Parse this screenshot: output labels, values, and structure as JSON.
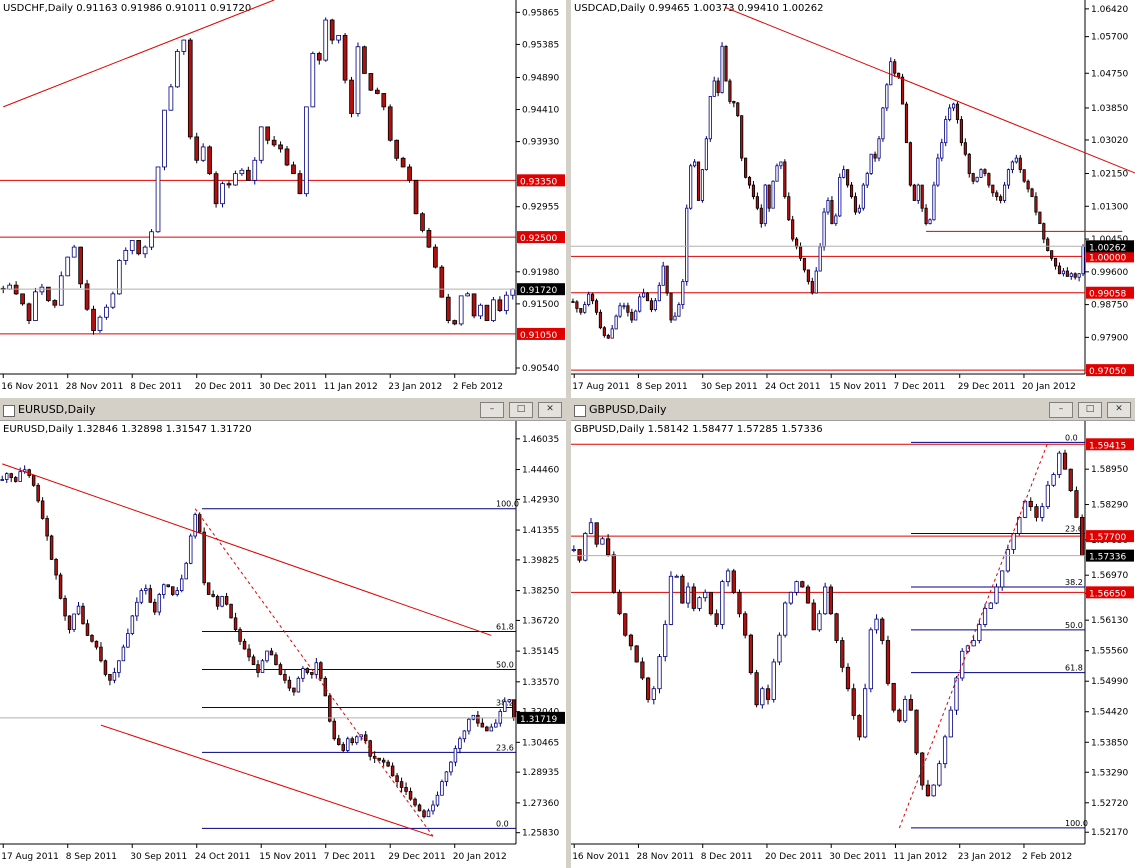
{
  "colors": {
    "bull": "#ffffff",
    "bull_outline": "#000080",
    "bear": "#b01010",
    "bear_outline": "#000000",
    "level_line": "#e00000",
    "fib_line": "#000080",
    "axis_text": "#000000",
    "price_box_black": "#000000",
    "price_box_red": "#e00000"
  },
  "window_buttons": {
    "minimize": "–",
    "maximize": "□",
    "close": "✕"
  },
  "chart_data": [
    {
      "type": "candlestick",
      "symbol": "USDCHF",
      "title": "USDCHF,Daily",
      "ohlc_label": "0.91163 0.91986 0.91011 0.91720",
      "ylim": [
        0.9045,
        0.9605
      ],
      "yticks": [
        0.95865,
        0.95385,
        0.9489,
        0.9441,
        0.9393,
        0.92955,
        0.9198,
        0.915,
        0.9054
      ],
      "xticks": [
        "16 Nov 2011",
        "28 Nov 2011",
        "8 Dec 2011",
        "20 Dec 2011",
        "30 Dec 2011",
        "11 Jan 2012",
        "23 Jan 2012",
        "2 Feb 2012"
      ],
      "levels": [
        {
          "price": 0.9335,
          "label": "0.93350"
        },
        {
          "price": 0.925,
          "label": "0.92500"
        },
        {
          "price": 0.9105,
          "label": "0.91050"
        }
      ],
      "current_price": {
        "price": 0.9172,
        "label": "0.91720"
      },
      "trendlines": [
        {
          "from": [
            0,
            0.9445
          ],
          "to": [
            42,
            0.9605
          ]
        }
      ],
      "points": [
        0.9172,
        0.9178,
        0.9165,
        0.915,
        0.9125,
        0.9168,
        0.9175,
        0.9155,
        0.9148,
        0.9192,
        0.922,
        0.9235,
        0.918,
        0.9142,
        0.911,
        0.913,
        0.9145,
        0.9165,
        0.9215,
        0.923,
        0.9245,
        0.9225,
        0.9235,
        0.9258,
        0.9355,
        0.944,
        0.9475,
        0.9528,
        0.9545,
        0.94,
        0.9365,
        0.9385,
        0.9345,
        0.93,
        0.933,
        0.9328,
        0.9345,
        0.935,
        0.9335,
        0.9365,
        0.9415,
        0.9395,
        0.9388,
        0.9382,
        0.9358,
        0.9345,
        0.9315,
        0.9445,
        0.9525,
        0.9515,
        0.9575,
        0.9545,
        0.9552,
        0.9485,
        0.9435,
        0.9535,
        0.9495,
        0.947,
        0.9465,
        0.9445,
        0.9395,
        0.9368,
        0.9355,
        0.9335,
        0.9285,
        0.926,
        0.9235,
        0.9205,
        0.916,
        0.9125,
        0.912,
        0.9162,
        0.9165,
        0.9132,
        0.9148,
        0.9125,
        0.9156,
        0.914,
        0.9163,
        0.9172
      ]
    },
    {
      "type": "candlestick",
      "symbol": "USDCAD",
      "title": "USDCAD,Daily",
      "ohlc_label": "0.99465 1.00373 0.99410 1.00262",
      "ylim": [
        0.9695,
        1.0665
      ],
      "yticks": [
        1.0642,
        1.057,
        1.0475,
        1.0385,
        1.0302,
        1.0215,
        1.013,
        1.0045,
        0.996,
        0.9875,
        0.979
      ],
      "xticks": [
        "17 Aug 2011",
        "8 Sep 2011",
        "30 Sep 2011",
        "24 Oct 2011",
        "15 Nov 2011",
        "7 Dec 2011",
        "29 Dec 2011",
        "20 Jan 2012"
      ],
      "levels": [
        {
          "price": 1.0,
          "label": "1.00000"
        },
        {
          "price": 0.99058,
          "label": "0.99058"
        },
        {
          "price": 0.9705,
          "label": "0.97050"
        }
      ],
      "segments": [
        {
          "from": [
            90,
            1.0065
          ],
          "to": [
            140,
            1.0065
          ]
        }
      ],
      "current_price": {
        "price": 1.00262,
        "label": "1.00262"
      },
      "trendlines": [
        {
          "from": [
            39,
            1.0645
          ],
          "to": [
            146,
            1.0205
          ]
        }
      ],
      "points": [
        0.9882,
        0.9865,
        0.9855,
        0.9875,
        0.9902,
        0.9885,
        0.9855,
        0.9815,
        0.9795,
        0.9788,
        0.9812,
        0.9845,
        0.9872,
        0.9872,
        0.9855,
        0.9835,
        0.9858,
        0.9895,
        0.9905,
        0.9885,
        0.9862,
        0.9885,
        0.9925,
        0.9975,
        0.9905,
        0.9835,
        0.9845,
        0.9875,
        0.9935,
        1.0125,
        1.0235,
        1.0245,
        1.0145,
        1.0225,
        1.0305,
        1.0415,
        1.0455,
        1.0425,
        1.0545,
        1.0455,
        1.0402,
        1.0398,
        1.0365,
        1.0255,
        1.0205,
        1.0185,
        1.0155,
        1.0125,
        1.0085,
        1.0185,
        1.0125,
        1.0195,
        1.0235,
        1.0245,
        1.0155,
        1.0095,
        1.0045,
        1.0025,
        0.9995,
        0.9965,
        0.9935,
        0.9905,
        0.9962,
        1.0025,
        1.0115,
        1.0145,
        1.0085,
        1.0105,
        1.0205,
        1.0225,
        1.0185,
        1.0155,
        1.0115,
        1.0125,
        1.0185,
        1.0215,
        1.0265,
        1.0255,
        1.0305,
        1.0385,
        1.0445,
        1.0505,
        1.0475,
        1.0465,
        1.0395,
        1.0295,
        1.0185,
        1.0145,
        1.0185,
        1.0125,
        1.0085,
        1.0095,
        1.0185,
        1.0255,
        1.0295,
        1.0355,
        1.0385,
        1.0395,
        1.0355,
        1.0295,
        1.0265,
        1.0215,
        1.0195,
        1.0205,
        1.0225,
        1.0215,
        1.0185,
        1.0165,
        1.0155,
        1.0145,
        1.0185,
        1.0225,
        1.0245,
        1.0255,
        1.0225,
        1.0195,
        1.0175,
        1.0155,
        1.0115,
        1.0085,
        1.0045,
        1.0015,
        0.9995,
        0.9975,
        0.9955,
        0.9962,
        0.9948,
        0.9955,
        0.9946,
        0.9955,
        1.0026
      ]
    },
    {
      "type": "candlestick",
      "symbol": "EURUSD",
      "title": "EURUSD,Daily",
      "window_title": "EURUSD,Daily",
      "ohlc_label": "1.32846 1.32898 1.31547 1.31720",
      "ylim": [
        1.2525,
        1.4695
      ],
      "yticks": [
        1.46035,
        1.4446,
        1.4293,
        1.41355,
        1.39825,
        1.3825,
        1.3672,
        1.35145,
        1.3357,
        1.3204,
        1.30465,
        1.28935,
        1.2736,
        1.2583
      ],
      "xticks": [
        "17 Aug 2011",
        "8 Sep 2011",
        "30 Sep 2011",
        "24 Oct 2011",
        "15 Nov 2011",
        "7 Dec 2011",
        "29 Dec 2011",
        "20 Jan 2012"
      ],
      "current_price": {
        "price": 1.3172,
        "label": "1.31719"
      },
      "fib_levels": [
        {
          "price": 1.4245,
          "label": "100.0"
        },
        {
          "price": 1.3615,
          "label": "61.8"
        },
        {
          "price": 1.342,
          "label": "50.0"
        },
        {
          "price": 1.3225,
          "label": "38.2"
        },
        {
          "price": 1.2995,
          "label": "23.6"
        },
        {
          "price": 1.2605,
          "label": "0.0"
        }
      ],
      "trendlines": [
        {
          "from": [
            0,
            1.4475
          ],
          "to": [
            109,
            1.3595
          ]
        },
        {
          "from": [
            22,
            1.3135
          ],
          "to": [
            96,
            1.2565
          ]
        }
      ],
      "dashed_lines": [
        {
          "from": [
            43,
            1.4245
          ],
          "to": [
            96,
            1.2565
          ]
        }
      ],
      "points": [
        1.4395,
        1.4425,
        1.4405,
        1.4385,
        1.4435,
        1.4445,
        1.4415,
        1.4365,
        1.4285,
        1.4195,
        1.4105,
        1.3985,
        1.3905,
        1.3785,
        1.3695,
        1.3625,
        1.3705,
        1.3745,
        1.3655,
        1.3595,
        1.3565,
        1.3535,
        1.3465,
        1.3395,
        1.3365,
        1.3405,
        1.3465,
        1.3535,
        1.3605,
        1.3695,
        1.3765,
        1.3825,
        1.3835,
        1.3765,
        1.3715,
        1.3805,
        1.3855,
        1.3845,
        1.3805,
        1.3825,
        1.3885,
        1.3965,
        1.4105,
        1.4215,
        1.4125,
        1.3865,
        1.3805,
        1.3795,
        1.3745,
        1.3795,
        1.3755,
        1.3685,
        1.3625,
        1.3565,
        1.3525,
        1.3485,
        1.3445,
        1.3405,
        1.3465,
        1.3515,
        1.3495,
        1.3445,
        1.3395,
        1.3365,
        1.3325,
        1.3305,
        1.3375,
        1.3425,
        1.3405,
        1.3395,
        1.3455,
        1.3375,
        1.3285,
        1.3155,
        1.3065,
        1.3035,
        1.3005,
        1.3065,
        1.3045,
        1.3075,
        1.3085,
        1.3055,
        1.2975,
        1.2965,
        1.2955,
        1.2945,
        1.2925,
        1.2875,
        1.2845,
        1.2815,
        1.2795,
        1.2755,
        1.2725,
        1.2695,
        1.2665,
        1.2695,
        1.2725,
        1.2775,
        1.2845,
        1.2895,
        1.2945,
        1.3015,
        1.3065,
        1.3105,
        1.3165,
        1.3185,
        1.3145,
        1.3125,
        1.3105,
        1.3125,
        1.3145,
        1.3205,
        1.3255,
        1.3265,
        1.3172
      ]
    },
    {
      "type": "candlestick",
      "symbol": "GBPUSD",
      "title": "GBPUSD,Daily",
      "window_title": "GBPUSD,Daily",
      "ohlc_label": "1.58142 1.58477 1.57285 1.57336",
      "ylim": [
        1.5195,
        1.5985
      ],
      "yticks": [
        1.5895,
        1.5829,
        1.5763,
        1.5697,
        1.5663,
        1.5613,
        1.5556,
        1.5499,
        1.5442,
        1.5385,
        1.5329,
        1.5272,
        1.5217
      ],
      "xticks": [
        "16 Nov 2011",
        "28 Nov 2011",
        "8 Dec 2011",
        "20 Dec 2011",
        "30 Dec 2011",
        "11 Jan 2012",
        "23 Jan 2012",
        "2 Feb 2012"
      ],
      "levels": [
        {
          "price": 1.59415,
          "label": "1.59415"
        },
        {
          "price": 1.577,
          "label": "1.57700"
        },
        {
          "price": 1.5665,
          "label": "1.56650"
        }
      ],
      "current_price": {
        "price": 1.57336,
        "label": "1.57336"
      },
      "fib_levels": [
        {
          "price": 1.5945,
          "label": "0.0"
        },
        {
          "price": 1.5775,
          "label": "23.6"
        },
        {
          "price": 1.5675,
          "label": "38.2"
        },
        {
          "price": 1.5595,
          "label": "50.0"
        },
        {
          "price": 1.5515,
          "label": "61.8"
        },
        {
          "price": 1.5225,
          "label": "100.0"
        }
      ],
      "dashed_lines": [
        {
          "from": [
            57,
            1.5225
          ],
          "to": [
            83,
            1.5945
          ]
        }
      ],
      "points": [
        1.5745,
        1.5725,
        1.5775,
        1.5795,
        1.5755,
        1.5765,
        1.5735,
        1.5665,
        1.5625,
        1.5585,
        1.5565,
        1.5535,
        1.5505,
        1.5465,
        1.5485,
        1.5545,
        1.5605,
        1.5695,
        1.5695,
        1.5645,
        1.5675,
        1.5635,
        1.5655,
        1.5665,
        1.5625,
        1.5605,
        1.5685,
        1.5705,
        1.5665,
        1.5625,
        1.5585,
        1.5515,
        1.5455,
        1.5485,
        1.5465,
        1.5535,
        1.5585,
        1.5645,
        1.5665,
        1.5685,
        1.5675,
        1.5645,
        1.5595,
        1.5625,
        1.5675,
        1.5625,
        1.5575,
        1.5525,
        1.5485,
        1.5435,
        1.5395,
        1.5485,
        1.5595,
        1.5615,
        1.5575,
        1.5495,
        1.5445,
        1.5425,
        1.5465,
        1.5445,
        1.5365,
        1.5305,
        1.5285,
        1.5305,
        1.5345,
        1.5395,
        1.5445,
        1.5505,
        1.5555,
        1.5565,
        1.5575,
        1.5605,
        1.5635,
        1.5645,
        1.5675,
        1.5705,
        1.5745,
        1.5775,
        1.5805,
        1.5835,
        1.5825,
        1.5805,
        1.5825,
        1.5865,
        1.5885,
        1.5925,
        1.5895,
        1.5855,
        1.5805,
        1.5734
      ]
    }
  ]
}
